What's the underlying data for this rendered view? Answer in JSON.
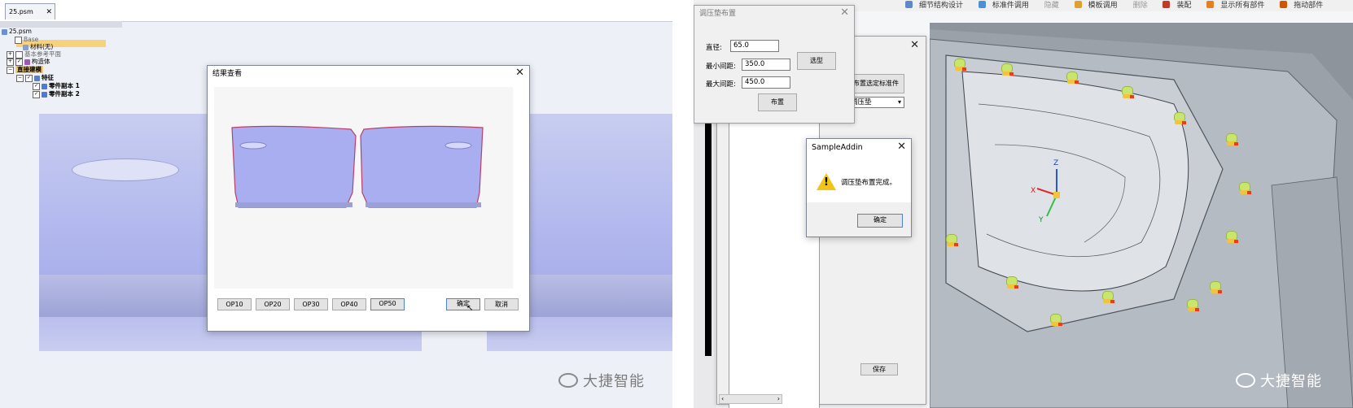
{
  "left": {
    "tab_name": "25.psm",
    "tree": {
      "root": "25.psm",
      "base": "Base",
      "material": "材料(无)",
      "ref_planes": "基本参考平面",
      "construction": "构造体",
      "direct_modeling": "直接建模",
      "features": "特征",
      "part_copy_1": "零件副本 1",
      "part_copy_2": "零件副本 2"
    },
    "result_dialog": {
      "title": "结果查看",
      "op_buttons": [
        "OP10",
        "OP20",
        "OP30",
        "OP40",
        "OP50"
      ],
      "confirm": "确定",
      "cancel": "取消"
    },
    "watermark": "大捷智能"
  },
  "right": {
    "toolbar": [
      "细节结构设计",
      "标准件调用",
      "隐藏",
      "模板调用",
      "删除",
      "装配",
      "显示所有部件",
      "拖动部件"
    ],
    "pad_dialog": {
      "title": "调压垫布置",
      "diameter_label": "直径:",
      "diameter_value": "65.0",
      "min_spacing_label": "最小间距:",
      "min_spacing_value": "350.0",
      "max_spacing_label": "最大间距:",
      "max_spacing_value": "450.0",
      "select_button": "选型",
      "layout_button": "布置"
    },
    "std_dialog": {
      "place_button": "布置选定标准件",
      "type_value": "调压垫",
      "save_button": "保存"
    },
    "message_box": {
      "title": "SampleAddin",
      "message": "调压垫布置完成。",
      "ok": "确定"
    },
    "axes": {
      "x": "X",
      "y": "Y",
      "z": "Z"
    },
    "watermark": "大捷智能"
  },
  "colors": {
    "highlight": "#f7d27c",
    "part_fill": "#b7bcef",
    "pad_green": "#c8e66d",
    "pad_yellow": "#f0c43c",
    "warning": "#f2c418",
    "primary_border": "#4f81d3"
  }
}
